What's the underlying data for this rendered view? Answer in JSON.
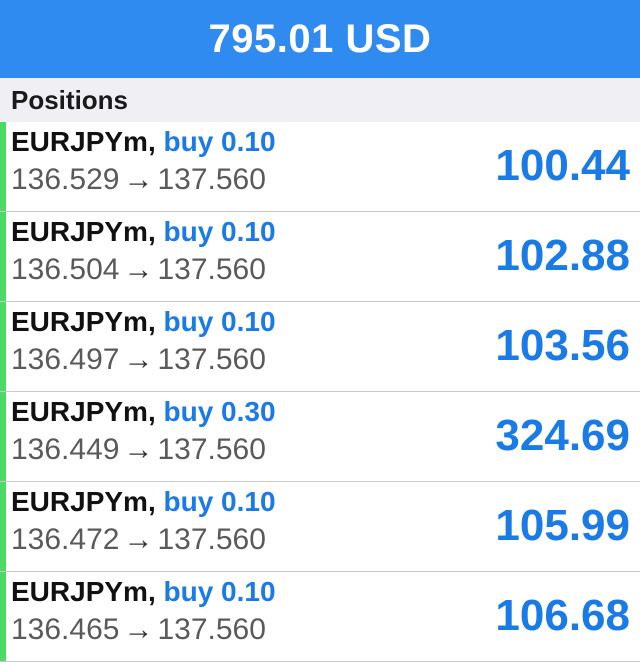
{
  "header": {
    "total": "795.01 USD"
  },
  "section": {
    "title": "Positions"
  },
  "colors": {
    "header_bg": "#2f8bf0",
    "accent_blue": "#1b7be6",
    "profit_marker_green": "#4cd964"
  },
  "positions": [
    {
      "symbol": "EURJPYm",
      "separator": ",",
      "side_volume": "buy 0.10",
      "open_price": "136.529",
      "arrow": "→",
      "current_price": "137.560",
      "profit": "100.44"
    },
    {
      "symbol": "EURJPYm",
      "separator": ",",
      "side_volume": "buy 0.10",
      "open_price": "136.504",
      "arrow": "→",
      "current_price": "137.560",
      "profit": "102.88"
    },
    {
      "symbol": "EURJPYm",
      "separator": ",",
      "side_volume": "buy 0.10",
      "open_price": "136.497",
      "arrow": "→",
      "current_price": "137.560",
      "profit": "103.56"
    },
    {
      "symbol": "EURJPYm",
      "separator": ",",
      "side_volume": "buy 0.30",
      "open_price": "136.449",
      "arrow": "→",
      "current_price": "137.560",
      "profit": "324.69"
    },
    {
      "symbol": "EURJPYm",
      "separator": ",",
      "side_volume": "buy 0.10",
      "open_price": "136.472",
      "arrow": "→",
      "current_price": "137.560",
      "profit": "105.99"
    },
    {
      "symbol": "EURJPYm",
      "separator": ",",
      "side_volume": "buy 0.10",
      "open_price": "136.465",
      "arrow": "→",
      "current_price": "137.560",
      "profit": "106.68"
    }
  ]
}
